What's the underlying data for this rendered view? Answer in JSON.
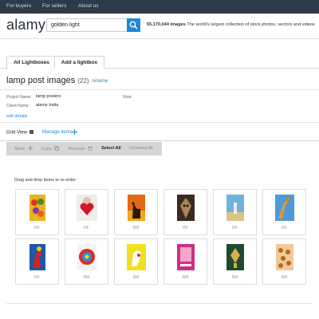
{
  "top_nav": {
    "buyers": "For buyers",
    "sellers": "For sellers",
    "about": "About us"
  },
  "header": {
    "logo": "alamy",
    "search_value": "golden light",
    "image_count": "55,170,044 images",
    "tagline": "The world's largest collection of stock photos, vectors and videos"
  },
  "tabs": [
    {
      "label": "All Lightboxes",
      "active": true
    },
    {
      "label": "Add a lightbox",
      "active": false
    }
  ],
  "lightbox": {
    "title": "lamp post images",
    "count": "(22)",
    "rename": "rename",
    "project_name_label": "Project Name:",
    "project_name": "lamp posters",
    "client_name_label": "Client Name:",
    "client_name": "alamy India",
    "note_label": "Note:",
    "edit_details": "edit details"
  },
  "view": {
    "grid_view": "Grid View",
    "manage_items": "Manage items"
  },
  "toolbar": {
    "move": "Move",
    "copy": "Copy",
    "remove": "Remove",
    "select_all": "Select All",
    "unselect_all": "UnSelect All"
  },
  "drag_hint": "Drag and drop items to re-order",
  "items": [
    {
      "license": "RF",
      "icon": "colorful-flowers-thumbnail"
    },
    {
      "license": "RF",
      "icon": "woman-holding-heart-thumbnail"
    },
    {
      "license": "RM",
      "icon": "giraffe-sunset-thumbnail"
    },
    {
      "license": "RF",
      "icon": "mask-face-thumbnail"
    },
    {
      "license": "RF",
      "icon": "sky-lighthouse-thumbnail"
    },
    {
      "license": "RF",
      "icon": "giraffe-sky-thumbnail"
    },
    {
      "license": "RF",
      "icon": "colorful-figure-thumbnail"
    },
    {
      "license": "RM",
      "icon": "red-target-thumbnail"
    },
    {
      "license": "RM",
      "icon": "yellow-hand-thumbnail"
    },
    {
      "license": "RM",
      "icon": "pink-poster-thumbnail"
    },
    {
      "license": "RM",
      "icon": "green-ornament-thumbnail"
    },
    {
      "license": "RM",
      "icon": "giraffe-pattern-thumbnail"
    }
  ],
  "colors": {
    "nav_bg": "#2d3a4a",
    "accent": "#1c8ad9",
    "toolbar_bg": "#d6d6d6"
  }
}
